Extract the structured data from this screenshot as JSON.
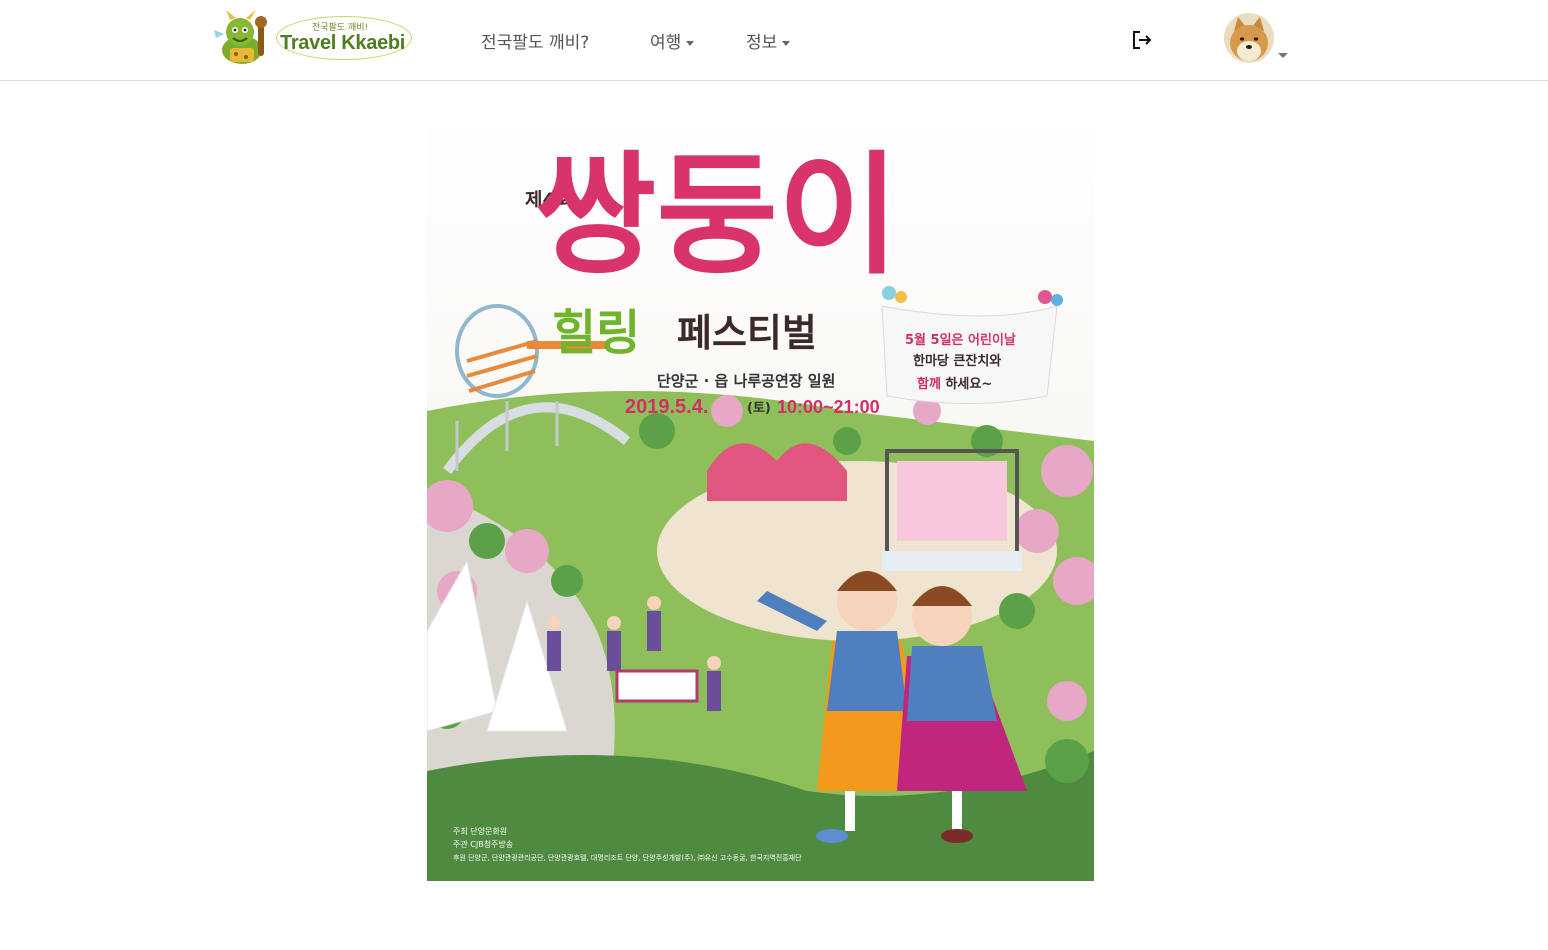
{
  "logo": {
    "small_text": "전국팔도 깨비!",
    "main_text": "Travel Kkaebi"
  },
  "nav": {
    "items": [
      {
        "label": "전국팔도 깨비?"
      },
      {
        "label": "여행"
      },
      {
        "label": "정보"
      }
    ]
  },
  "icons": {
    "logout": "logout-icon",
    "avatar": "avatar-shiba",
    "prev": "chevron-left-icon",
    "next": "chevron-right-icon"
  },
  "poster": {
    "edition": "제4회",
    "title_main": "쌍둥이",
    "title_sub_green": "힐링",
    "title_sub_dark": "페스티벌",
    "location": "단양군 · 읍 나루공연장 일원",
    "date": "2019.5.4.",
    "day": "(토)",
    "time": "10:00~21:00",
    "banner_line1_a": "5월 5일은 ",
    "banner_line1_b": "어린이날",
    "banner_line2": "한마당 큰잔치와",
    "banner_line3_a": "함께",
    "banner_line3_b": " 하세요~",
    "credit1": "주최  단양문화원",
    "credit2": "주관  CJB청주방송",
    "credit3": "후원  단양군, 단양관광관리공단, 단양관광호텔, 대명리조트 단양, 단양주성개발(주), ㈜유신 고수동굴, 한국지역진흥재단"
  },
  "colors": {
    "nav_text": "#555555",
    "logo_green": "#4f7d1f",
    "title_pink": "#d9336b",
    "title_dark": "#5a2a35",
    "title_green": "#6fb52c",
    "date_pink": "#d22f68",
    "grass": "#4f8e3f"
  }
}
